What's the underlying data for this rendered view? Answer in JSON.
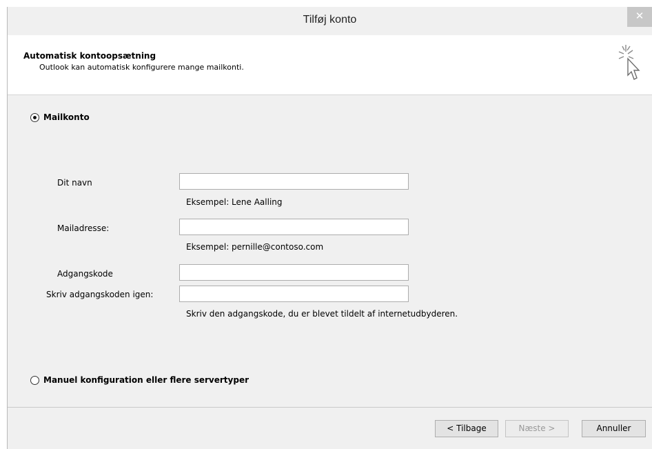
{
  "window": {
    "title": "Tilføj konto",
    "close_glyph": "✕"
  },
  "header": {
    "title": "Automatisk kontoopsætning",
    "subtitle": "Outlook kan automatisk konfigurere mange mailkonti.",
    "icon": "wizard-cursor-icon"
  },
  "options": {
    "mail_account": {
      "label": "Mailkonto",
      "selected": true
    },
    "manual": {
      "label": "Manuel konfiguration eller flere servertyper",
      "selected": false
    }
  },
  "form": {
    "name": {
      "label": "Dit navn",
      "value": "",
      "hint": "Eksempel: Lene Aalling"
    },
    "email": {
      "label": "Mailadresse:",
      "value": "",
      "hint": "Eksempel: pernille@contoso.com"
    },
    "password": {
      "label": "Adgangskode",
      "value": ""
    },
    "password_repeat": {
      "label": "Skriv adgangskoden igen:",
      "value": "",
      "hint": "Skriv den adgangskode, du er blevet tildelt af internetudbyderen."
    }
  },
  "buttons": {
    "back": "< Tilbage",
    "next": "Næste >",
    "cancel": "Annuller"
  }
}
